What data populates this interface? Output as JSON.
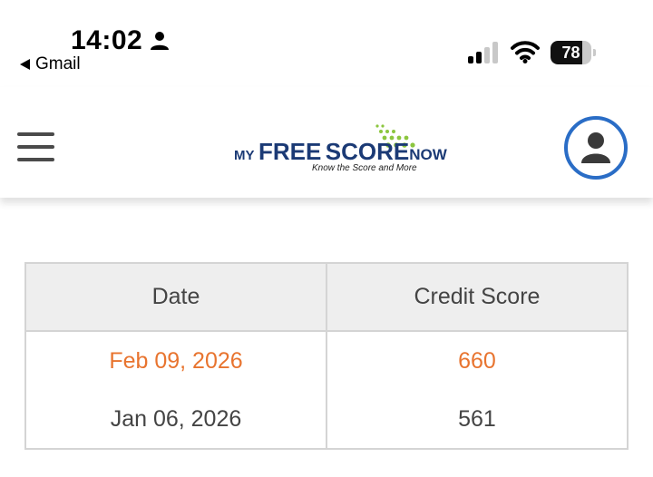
{
  "status_bar": {
    "time": "14:02",
    "back_app_label": "Gmail",
    "battery_level": "78",
    "battery_fraction": 0.78,
    "signal_bars_active": 2,
    "signal_bars_total": 4
  },
  "header": {
    "logo": {
      "my": "MY",
      "free": "FREE",
      "score": "SCORE",
      "now": "NOW",
      "tagline": "Know the Score and More"
    },
    "colors": {
      "logo_text": "#1b3a75",
      "logo_dots": "#8cc63f",
      "avatar_ring": "#2a6dc6"
    }
  },
  "table": {
    "headers": [
      "Date",
      "Credit Score"
    ],
    "rows": [
      {
        "date": "Feb 09, 2026",
        "score": "660",
        "highlight": true
      },
      {
        "date": "Jan 06, 2026",
        "score": "561",
        "highlight": false
      }
    ],
    "highlight_color": "#e8742f"
  }
}
